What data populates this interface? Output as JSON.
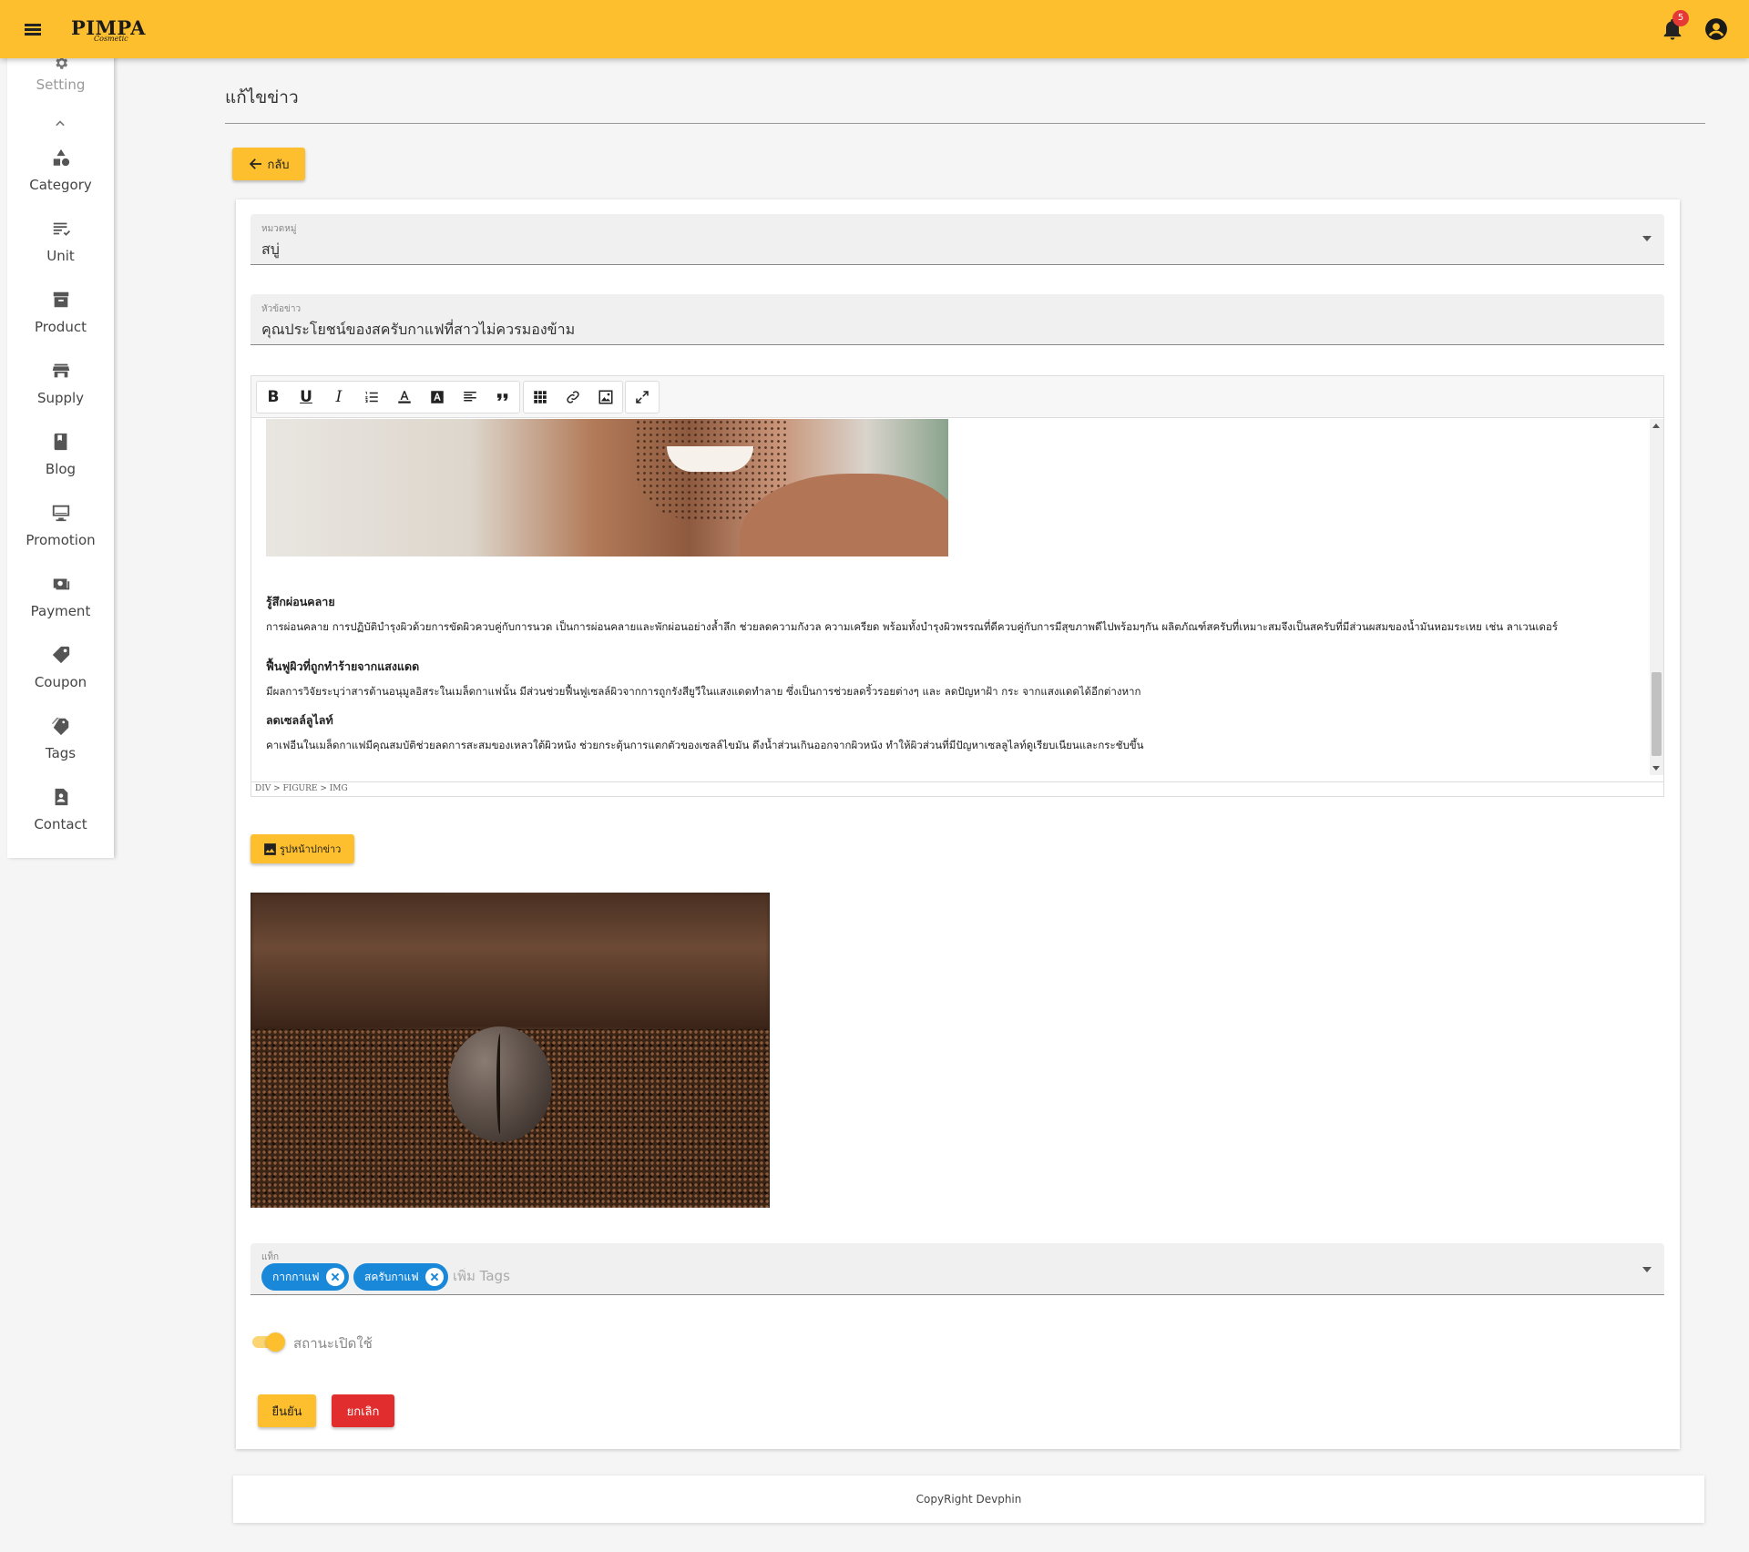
{
  "header": {
    "logo_main": "PIMPA",
    "logo_sub": "Cosmetic",
    "notification_count": "5",
    "brand_color": "#FDBF2D"
  },
  "sidebar": {
    "items": [
      {
        "label": "Setting",
        "icon": "gear-icon"
      },
      {
        "label": "Category",
        "icon": "shapes-icon"
      },
      {
        "label": "Unit",
        "icon": "list-check-icon"
      },
      {
        "label": "Product",
        "icon": "archive-icon"
      },
      {
        "label": "Supply",
        "icon": "store-icon"
      },
      {
        "label": "Blog",
        "icon": "book-icon"
      },
      {
        "label": "Promotion",
        "icon": "monitor-icon"
      },
      {
        "label": "Payment",
        "icon": "money-icon"
      },
      {
        "label": "Coupon",
        "icon": "tag-icon"
      },
      {
        "label": "Tags",
        "icon": "tags-icon"
      },
      {
        "label": "Contact",
        "icon": "contact-icon"
      }
    ]
  },
  "page": {
    "title": "แก้ไขข่าว",
    "back_label": "กลับ"
  },
  "form": {
    "category": {
      "label": "หมวดหมู่",
      "value": "สบู่"
    },
    "headline": {
      "label": "หัวข้อข่าว",
      "value": "คุณประโยชน์ของสครับกาแฟที่สาวไม่ควรมองข้าม"
    },
    "editor": {
      "sections": [
        {
          "heading": "รู้สึกผ่อนคลาย",
          "body": "การผ่อนคลาย การปฏิบัติบำรุงผิวด้วยการขัดผิวควบคู่กับการนวด เป็นการผ่อนคลายและพักผ่อนอย่างล้ำลึก ช่วยลดความกังวล ความเครียด พร้อมทั้งบำรุงผิวพรรณที่ดีควบคู่กับการมีสุขภาพดีไปพร้อมๆกัน ผลิตภัณฑ์สครับที่เหมาะสมจึงเป็นสครับที่มีส่วนผสมของน้ำมันหอมระเหย เช่น ลาเวนเดอร์"
        },
        {
          "heading": "ฟื้นฟูผิวที่ถูกทำร้ายจากแสงแดด",
          "body": "มีผลการวิจัยระบุว่าสารต้านอนุมูลอิสระในเมล็ดกาแฟนั้น มีส่วนช่วยฟื้นฟูเซลล์ผิวจากการถูกรังสียูวีในแสงแดดทำลาย ซึ่งเป็นการช่วยลดริ้วรอยต่างๆ และ ลดปัญหาฝ้า กระ จากแสงแดดได้อีกต่างหาก"
        },
        {
          "heading": "ลดเซลล์ลูไลท์",
          "body": "คาเฟอีนในเมล็ดกาแฟมีคุณสมบัติช่วยลดการสะสมของเหลวใต้ผิวหนัง ช่วยกระตุ้นการแตกตัวของเซลล์ไขมัน ดึงน้ำส่วนเกินออกจากผิวหนัง ทำให้ผิวส่วนที่มีปัญหาเซลลูไลท์ดูเรียบเนียนและกระชับขึ้น"
        }
      ],
      "path": "DIV > FIGURE > IMG"
    },
    "cover_button": "รูปหน้าปกข่าว",
    "tags": {
      "label": "แท็ก",
      "chips": [
        "กากกาแฟ",
        "สครับกาแฟ"
      ],
      "placeholder": "เพิ่ม Tags"
    },
    "status": {
      "label": "สถานะเปิดใช้",
      "on": true
    },
    "confirm_label": "ยืนยัน",
    "cancel_label": "ยกเลิก",
    "danger_color": "#e12d2d",
    "chip_color": "#1a88d8"
  },
  "footer": {
    "text": "CopyRight Devphin"
  }
}
